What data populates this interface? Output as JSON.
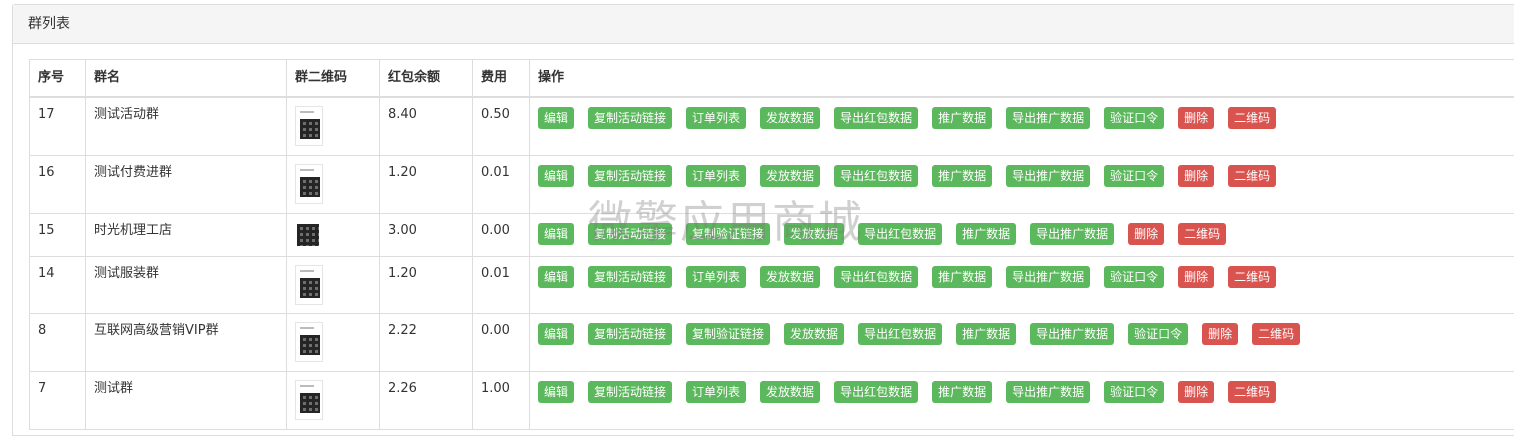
{
  "panel": {
    "title": "群列表"
  },
  "table": {
    "headers": [
      "序号",
      "群名",
      "群二维码",
      "红包余额",
      "费用",
      "操作"
    ],
    "rows": [
      {
        "id": "17",
        "name": "测试活动群",
        "balance": "8.40",
        "fee": "0.50",
        "actions": [
          {
            "label": "编辑",
            "color": "green"
          },
          {
            "label": "复制活动链接",
            "color": "green"
          },
          {
            "label": "订单列表",
            "color": "green"
          },
          {
            "label": "发放数据",
            "color": "green"
          },
          {
            "label": "导出红包数据",
            "color": "green"
          },
          {
            "label": "推广数据",
            "color": "green"
          },
          {
            "label": "导出推广数据",
            "color": "green"
          },
          {
            "label": "验证口令",
            "color": "green"
          },
          {
            "label": "删除",
            "color": "red"
          },
          {
            "label": "二维码",
            "color": "red"
          }
        ]
      },
      {
        "id": "16",
        "name": "测试付费进群",
        "balance": "1.20",
        "fee": "0.01",
        "actions": [
          {
            "label": "编辑",
            "color": "green"
          },
          {
            "label": "复制活动链接",
            "color": "green"
          },
          {
            "label": "订单列表",
            "color": "green"
          },
          {
            "label": "发放数据",
            "color": "green"
          },
          {
            "label": "导出红包数据",
            "color": "green"
          },
          {
            "label": "推广数据",
            "color": "green"
          },
          {
            "label": "导出推广数据",
            "color": "green"
          },
          {
            "label": "验证口令",
            "color": "green"
          },
          {
            "label": "删除",
            "color": "red"
          },
          {
            "label": "二维码",
            "color": "red"
          }
        ]
      },
      {
        "id": "15",
        "name": "时光机理工店",
        "balance": "3.00",
        "fee": "0.00",
        "actions": [
          {
            "label": "编辑",
            "color": "green"
          },
          {
            "label": "复制活动链接",
            "color": "green"
          },
          {
            "label": "复制验证链接",
            "color": "green"
          },
          {
            "label": "发放数据",
            "color": "green"
          },
          {
            "label": "导出红包数据",
            "color": "green"
          },
          {
            "label": "推广数据",
            "color": "green"
          },
          {
            "label": "导出推广数据",
            "color": "green"
          },
          {
            "label": "删除",
            "color": "red"
          },
          {
            "label": "二维码",
            "color": "red"
          }
        ]
      },
      {
        "id": "14",
        "name": "测试服装群",
        "balance": "1.20",
        "fee": "0.01",
        "actions": [
          {
            "label": "编辑",
            "color": "green"
          },
          {
            "label": "复制活动链接",
            "color": "green"
          },
          {
            "label": "订单列表",
            "color": "green"
          },
          {
            "label": "发放数据",
            "color": "green"
          },
          {
            "label": "导出红包数据",
            "color": "green"
          },
          {
            "label": "推广数据",
            "color": "green"
          },
          {
            "label": "导出推广数据",
            "color": "green"
          },
          {
            "label": "验证口令",
            "color": "green"
          },
          {
            "label": "删除",
            "color": "red"
          },
          {
            "label": "二维码",
            "color": "red"
          }
        ]
      },
      {
        "id": "8",
        "name": "互联网高级营销VIP群",
        "balance": "2.22",
        "fee": "0.00",
        "actions": [
          {
            "label": "编辑",
            "color": "green"
          },
          {
            "label": "复制活动链接",
            "color": "green"
          },
          {
            "label": "复制验证链接",
            "color": "green"
          },
          {
            "label": "发放数据",
            "color": "green"
          },
          {
            "label": "导出红包数据",
            "color": "green"
          },
          {
            "label": "推广数据",
            "color": "green"
          },
          {
            "label": "导出推广数据",
            "color": "green"
          },
          {
            "label": "验证口令",
            "color": "green"
          },
          {
            "label": "删除",
            "color": "red"
          },
          {
            "label": "二维码",
            "color": "red"
          }
        ]
      },
      {
        "id": "7",
        "name": "测试群",
        "balance": "2.26",
        "fee": "1.00",
        "actions": [
          {
            "label": "编辑",
            "color": "green"
          },
          {
            "label": "复制活动链接",
            "color": "green"
          },
          {
            "label": "订单列表",
            "color": "green"
          },
          {
            "label": "发放数据",
            "color": "green"
          },
          {
            "label": "导出红包数据",
            "color": "green"
          },
          {
            "label": "推广数据",
            "color": "green"
          },
          {
            "label": "导出推广数据",
            "color": "green"
          },
          {
            "label": "验证口令",
            "color": "green"
          },
          {
            "label": "删除",
            "color": "red"
          },
          {
            "label": "二维码",
            "color": "red"
          }
        ]
      }
    ]
  },
  "watermark": "微擎应用商城",
  "colors": {
    "green": "#5cb85c",
    "red": "#d9534f"
  }
}
